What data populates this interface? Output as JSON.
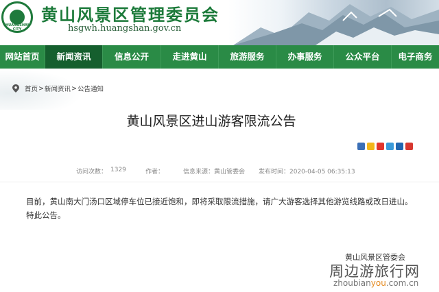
{
  "header": {
    "site_title": "黄山风景区管理委员会",
    "site_url": "hsgwh.huangshan.gov.cn",
    "logo_text": "HUANGSHAN CITY"
  },
  "nav": {
    "items": [
      {
        "label": "网站首页",
        "active": false
      },
      {
        "label": "新闻资讯",
        "active": true
      },
      {
        "label": "信息公开",
        "active": false
      },
      {
        "label": "走进黄山",
        "active": false
      },
      {
        "label": "旅游服务",
        "active": false
      },
      {
        "label": "办事服务",
        "active": false
      },
      {
        "label": "公众平台",
        "active": false
      },
      {
        "label": "电子商务",
        "active": false
      }
    ]
  },
  "breadcrumb": {
    "home": "首页",
    "sep": ">",
    "section": "新闻资讯",
    "sub": "公告通知"
  },
  "article": {
    "title": "黄山风景区进山游客限流公告",
    "views_label": "访问次数：",
    "views": "1329",
    "author_label": "作者：",
    "author": "",
    "source": "信息来源：黄山管委会",
    "published": "发布时间：2020-04-05 06:35:13",
    "paragraph_1": "目前，黄山南大门汤口区域停车位已接近饱和，即将采取限流措施，请广大游客选择其他游览线路或改日进山。",
    "paragraph_2": "特此公告。",
    "signature": "黄山风景区管委会"
  },
  "share_icons": [
    "share-plus-icon",
    "qzone-icon",
    "weibo-icon",
    "tencent-weibo-icon",
    "renren-icon",
    "kaixin-icon"
  ],
  "watermark": {
    "cn": "周边游旅行网",
    "en_prefix": "zhoubian",
    "en_highlight": "you",
    "en_suffix": ".com.cn"
  },
  "colors": {
    "nav_bg": "#2a8b46",
    "nav_active": "#155f2e",
    "title_green": "#1c7a3a"
  }
}
